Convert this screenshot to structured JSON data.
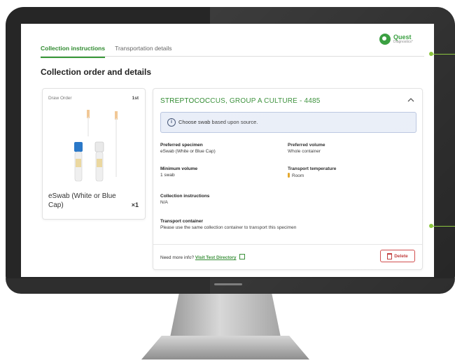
{
  "tabs": [
    {
      "label": "Collection instructions",
      "active": true
    },
    {
      "label": "Transportation details",
      "active": false
    }
  ],
  "logo": {
    "name": "Quest",
    "sub": "Diagnostics°",
    "color": "#2e9a35"
  },
  "page_title": "Collection order and details",
  "draw_card": {
    "label": "Draw Order",
    "order": "1st",
    "item_name": "eSwab (White or Blue Cap)",
    "quantity": "×1",
    "tubes": [
      {
        "cap_color": "#2a78c8",
        "label": "blue-cap-tube"
      },
      {
        "cap_color": "#e9e9e9",
        "label": "white-cap-tube"
      }
    ]
  },
  "detail_card": {
    "title": "STREPTOCOCCUS, GROUP A CULTURE - 4485",
    "notice": "Choose swab based upon source.",
    "fields": {
      "preferred_specimen": {
        "label": "Preferred specimen",
        "value": "eSwab (White or Blue Cap)"
      },
      "preferred_volume": {
        "label": "Preferred volume",
        "value": "Whole container"
      },
      "minimum_volume": {
        "label": "Minimum volume",
        "value": "1 swab"
      },
      "transport_temperature": {
        "label": "Transport temperature",
        "value": "Room"
      },
      "collection_instructions": {
        "label": "Collection instructions",
        "value": "N/A"
      },
      "transport_container": {
        "label": "Transport container",
        "value": "Please use the same collection container to transport this specimen"
      }
    },
    "more_info_text": "Need more info?",
    "more_info_link": "Visit Test Directory",
    "delete_label": "Delete"
  },
  "colors": {
    "accent": "#2f8a2f",
    "callout": "#8cc63f",
    "danger": "#c03a3a"
  }
}
